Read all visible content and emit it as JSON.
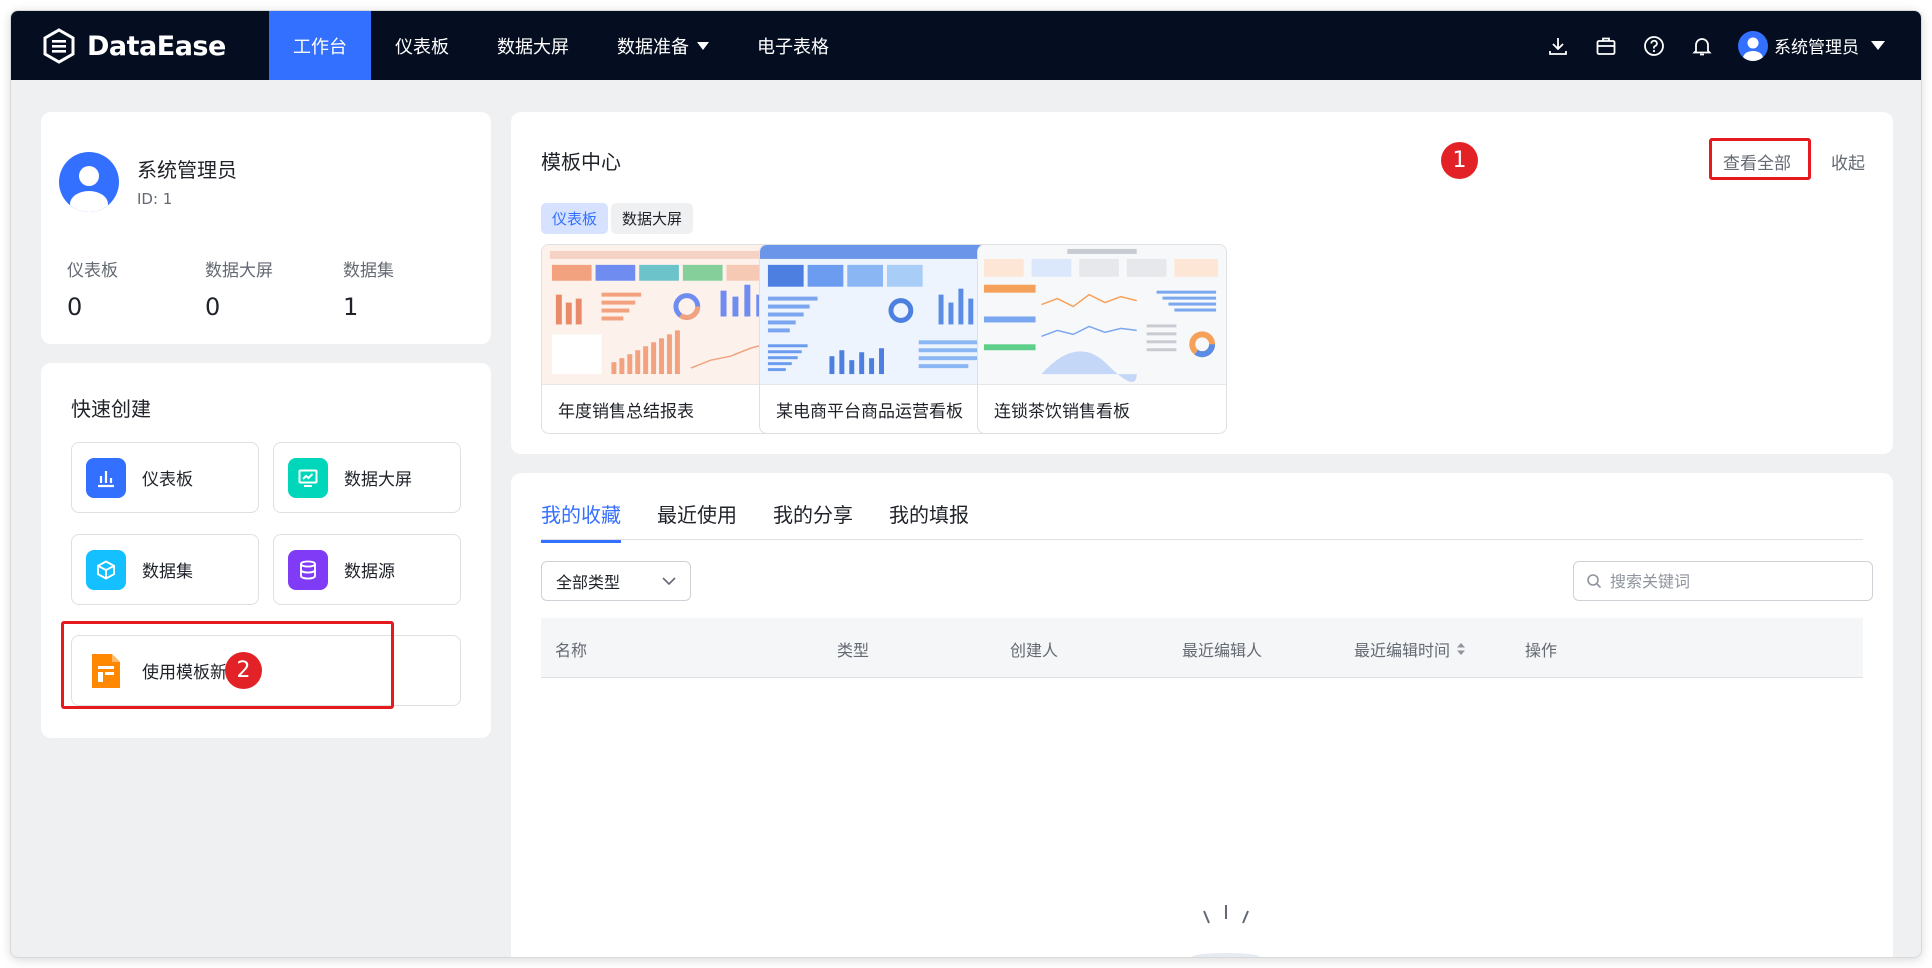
{
  "app": {
    "logo_text": "DataEase"
  },
  "nav": {
    "items": [
      {
        "label": "工作台",
        "active": true
      },
      {
        "label": "仪表板",
        "active": false
      },
      {
        "label": "数据大屏",
        "active": false
      },
      {
        "label": "数据准备",
        "active": false,
        "has_dropdown": true
      },
      {
        "label": "电子表格",
        "active": false
      }
    ]
  },
  "toolbar": {
    "icons": [
      "download-icon",
      "briefcase-icon",
      "help-icon",
      "bell-icon"
    ],
    "user_name": "系统管理员"
  },
  "profile": {
    "name": "系统管理员",
    "id_label": "ID: 1",
    "stats": [
      {
        "label": "仪表板",
        "value": "0"
      },
      {
        "label": "数据大屏",
        "value": "0"
      },
      {
        "label": "数据集",
        "value": "1"
      }
    ]
  },
  "quick_create": {
    "title": "快速创建",
    "buttons": [
      {
        "label": "仪表板",
        "icon": "bar-chart-icon",
        "color": "#3370ff"
      },
      {
        "label": "数据大屏",
        "icon": "screen-icon",
        "color": "#00d6b9"
      },
      {
        "label": "数据集",
        "icon": "cube-icon",
        "color": "#14c0ff"
      },
      {
        "label": "数据源",
        "icon": "database-icon",
        "color": "#7f3bf5"
      },
      {
        "label": "使用模板新建",
        "icon": "template-icon",
        "color": "#ff8800"
      }
    ]
  },
  "template_center": {
    "title": "模板中心",
    "view_all": "查看全部",
    "collapse": "收起",
    "tags": [
      {
        "label": "仪表板",
        "active": true
      },
      {
        "label": "数据大屏",
        "active": false
      }
    ],
    "templates": [
      {
        "name": "年度销售总结报表"
      },
      {
        "name": "某电商平台商品运营看板"
      },
      {
        "name": "连锁茶饮销售看板"
      }
    ]
  },
  "annotations": {
    "step1": "1",
    "step2": "2"
  },
  "resources": {
    "tabs": [
      {
        "label": "我的收藏",
        "active": true
      },
      {
        "label": "最近使用",
        "active": false
      },
      {
        "label": "我的分享",
        "active": false
      },
      {
        "label": "我的填报",
        "active": false
      }
    ],
    "type_filter": "全部类型",
    "search_placeholder": "搜索关键词",
    "columns": [
      "名称",
      "类型",
      "创建人",
      "最近编辑人",
      "最近编辑时间",
      "操作"
    ]
  },
  "colors": {
    "accent": "#3370ff",
    "topbar": "#050e21",
    "highlight": "#e5191e"
  }
}
